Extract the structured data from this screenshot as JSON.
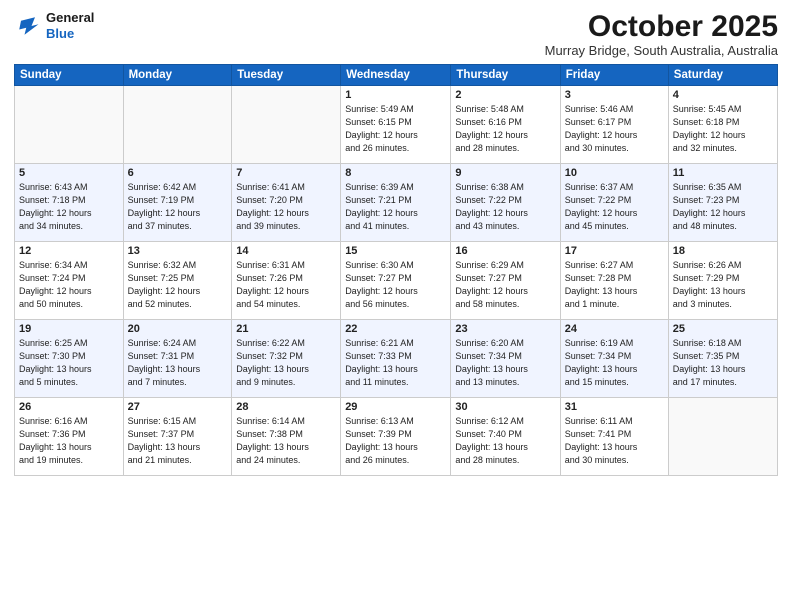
{
  "logo": {
    "line1": "General",
    "line2": "Blue"
  },
  "header": {
    "month": "October 2025",
    "location": "Murray Bridge, South Australia, Australia"
  },
  "weekdays": [
    "Sunday",
    "Monday",
    "Tuesday",
    "Wednesday",
    "Thursday",
    "Friday",
    "Saturday"
  ],
  "weeks": [
    [
      {
        "day": "",
        "info": ""
      },
      {
        "day": "",
        "info": ""
      },
      {
        "day": "",
        "info": ""
      },
      {
        "day": "1",
        "info": "Sunrise: 5:49 AM\nSunset: 6:15 PM\nDaylight: 12 hours\nand 26 minutes."
      },
      {
        "day": "2",
        "info": "Sunrise: 5:48 AM\nSunset: 6:16 PM\nDaylight: 12 hours\nand 28 minutes."
      },
      {
        "day": "3",
        "info": "Sunrise: 5:46 AM\nSunset: 6:17 PM\nDaylight: 12 hours\nand 30 minutes."
      },
      {
        "day": "4",
        "info": "Sunrise: 5:45 AM\nSunset: 6:18 PM\nDaylight: 12 hours\nand 32 minutes."
      }
    ],
    [
      {
        "day": "5",
        "info": "Sunrise: 6:43 AM\nSunset: 7:18 PM\nDaylight: 12 hours\nand 34 minutes."
      },
      {
        "day": "6",
        "info": "Sunrise: 6:42 AM\nSunset: 7:19 PM\nDaylight: 12 hours\nand 37 minutes."
      },
      {
        "day": "7",
        "info": "Sunrise: 6:41 AM\nSunset: 7:20 PM\nDaylight: 12 hours\nand 39 minutes."
      },
      {
        "day": "8",
        "info": "Sunrise: 6:39 AM\nSunset: 7:21 PM\nDaylight: 12 hours\nand 41 minutes."
      },
      {
        "day": "9",
        "info": "Sunrise: 6:38 AM\nSunset: 7:22 PM\nDaylight: 12 hours\nand 43 minutes."
      },
      {
        "day": "10",
        "info": "Sunrise: 6:37 AM\nSunset: 7:22 PM\nDaylight: 12 hours\nand 45 minutes."
      },
      {
        "day": "11",
        "info": "Sunrise: 6:35 AM\nSunset: 7:23 PM\nDaylight: 12 hours\nand 48 minutes."
      }
    ],
    [
      {
        "day": "12",
        "info": "Sunrise: 6:34 AM\nSunset: 7:24 PM\nDaylight: 12 hours\nand 50 minutes."
      },
      {
        "day": "13",
        "info": "Sunrise: 6:32 AM\nSunset: 7:25 PM\nDaylight: 12 hours\nand 52 minutes."
      },
      {
        "day": "14",
        "info": "Sunrise: 6:31 AM\nSunset: 7:26 PM\nDaylight: 12 hours\nand 54 minutes."
      },
      {
        "day": "15",
        "info": "Sunrise: 6:30 AM\nSunset: 7:27 PM\nDaylight: 12 hours\nand 56 minutes."
      },
      {
        "day": "16",
        "info": "Sunrise: 6:29 AM\nSunset: 7:27 PM\nDaylight: 12 hours\nand 58 minutes."
      },
      {
        "day": "17",
        "info": "Sunrise: 6:27 AM\nSunset: 7:28 PM\nDaylight: 13 hours\nand 1 minute."
      },
      {
        "day": "18",
        "info": "Sunrise: 6:26 AM\nSunset: 7:29 PM\nDaylight: 13 hours\nand 3 minutes."
      }
    ],
    [
      {
        "day": "19",
        "info": "Sunrise: 6:25 AM\nSunset: 7:30 PM\nDaylight: 13 hours\nand 5 minutes."
      },
      {
        "day": "20",
        "info": "Sunrise: 6:24 AM\nSunset: 7:31 PM\nDaylight: 13 hours\nand 7 minutes."
      },
      {
        "day": "21",
        "info": "Sunrise: 6:22 AM\nSunset: 7:32 PM\nDaylight: 13 hours\nand 9 minutes."
      },
      {
        "day": "22",
        "info": "Sunrise: 6:21 AM\nSunset: 7:33 PM\nDaylight: 13 hours\nand 11 minutes."
      },
      {
        "day": "23",
        "info": "Sunrise: 6:20 AM\nSunset: 7:34 PM\nDaylight: 13 hours\nand 13 minutes."
      },
      {
        "day": "24",
        "info": "Sunrise: 6:19 AM\nSunset: 7:34 PM\nDaylight: 13 hours\nand 15 minutes."
      },
      {
        "day": "25",
        "info": "Sunrise: 6:18 AM\nSunset: 7:35 PM\nDaylight: 13 hours\nand 17 minutes."
      }
    ],
    [
      {
        "day": "26",
        "info": "Sunrise: 6:16 AM\nSunset: 7:36 PM\nDaylight: 13 hours\nand 19 minutes."
      },
      {
        "day": "27",
        "info": "Sunrise: 6:15 AM\nSunset: 7:37 PM\nDaylight: 13 hours\nand 21 minutes."
      },
      {
        "day": "28",
        "info": "Sunrise: 6:14 AM\nSunset: 7:38 PM\nDaylight: 13 hours\nand 24 minutes."
      },
      {
        "day": "29",
        "info": "Sunrise: 6:13 AM\nSunset: 7:39 PM\nDaylight: 13 hours\nand 26 minutes."
      },
      {
        "day": "30",
        "info": "Sunrise: 6:12 AM\nSunset: 7:40 PM\nDaylight: 13 hours\nand 28 minutes."
      },
      {
        "day": "31",
        "info": "Sunrise: 6:11 AM\nSunset: 7:41 PM\nDaylight: 13 hours\nand 30 minutes."
      },
      {
        "day": "",
        "info": ""
      }
    ]
  ]
}
